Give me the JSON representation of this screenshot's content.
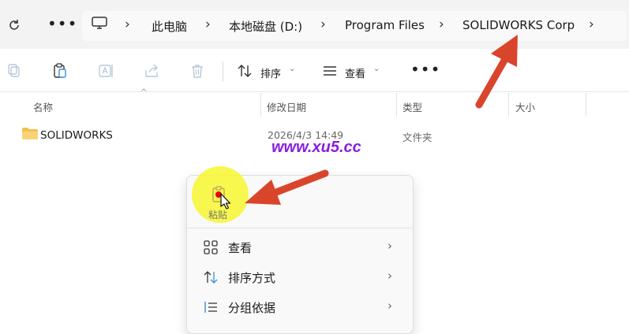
{
  "address_bar": {
    "breadcrumbs": [
      "此电脑",
      "本地磁盘 (D:)",
      "Program Files",
      "SOLIDWORKS Corp"
    ]
  },
  "toolbar": {
    "sort_label": "排序",
    "view_label": "查看"
  },
  "columns": {
    "name": "名称",
    "modified": "修改日期",
    "type": "类型",
    "size": "大小"
  },
  "files": [
    {
      "name": "SOLIDWORKS",
      "modified": "2026/4/3 14:49",
      "type": "文件夹",
      "size": ""
    }
  ],
  "watermark": "www.xu5.cc",
  "context_menu": {
    "paste_label": "粘贴",
    "items": [
      {
        "label": "查看",
        "icon": "grid-view-icon"
      },
      {
        "label": "排序方式",
        "icon": "sort-icon"
      },
      {
        "label": "分组依据",
        "icon": "group-list-icon"
      }
    ]
  },
  "colors": {
    "arrow": "#d9452b",
    "highlight": "#f6f628",
    "watermark": "#8a1fdc",
    "folder": "#f2c14e"
  }
}
